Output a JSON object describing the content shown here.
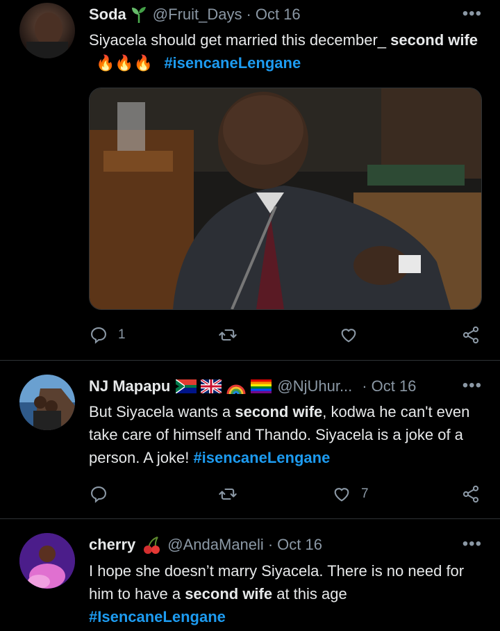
{
  "tweets": [
    {
      "name": "Soda",
      "handle": "@Fruit_Days",
      "date": "Oct 16",
      "text_plain": "Siyacela should get married this december_ ",
      "text_bold": "second wife",
      "emoji": "🔥🔥🔥",
      "hashtag": "#isencaneLengane",
      "reply_count": "1",
      "like_count": ""
    },
    {
      "name": "NJ Mapapu",
      "handle": "@NjUhur...",
      "date": "Oct 16",
      "text_a": "But Siyacela wants a ",
      "text_bold": "second wife",
      "text_b": ", kodwa he can't even take care of himself and Thando. Siyacela is a joke of a person. A joke! ",
      "hashtag": "#isencaneLengane",
      "reply_count": "",
      "like_count": "7"
    },
    {
      "name": "cherry",
      "handle": "@AndaManeli",
      "date": "Oct 16",
      "text_a": "I hope she doesn’t marry Siyacela. There is no need for him to have a ",
      "text_bold": "second wife",
      "text_b": " at this age",
      "hashtag": "#IsencaneLengane"
    }
  ],
  "separator": "·",
  "more": "•••",
  "colors": {
    "link": "#1d9bf0",
    "muted": "#8b98a5",
    "bg": "#000000"
  }
}
